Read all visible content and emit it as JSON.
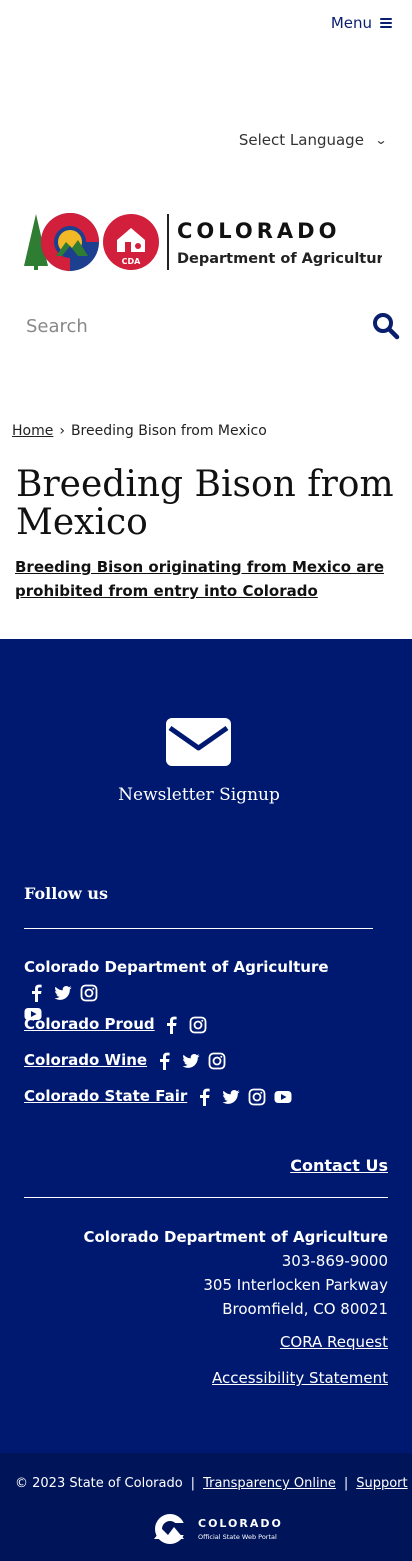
{
  "header": {
    "menu_label": "Menu",
    "language_label": "Select Language"
  },
  "logo": {
    "state_word": "COLORADO",
    "dept_name": "Department of Agriculture",
    "badge": "CDA"
  },
  "search": {
    "placeholder": "Search"
  },
  "breadcrumb": {
    "home": "Home",
    "separator": "›",
    "current": "Breeding Bison from Mexico"
  },
  "page": {
    "title": "Breeding Bison from Mexico",
    "link": "Breeding Bison originating from Mexico are prohibited from entry into Colorado"
  },
  "footer": {
    "newsletter_label": "Newsletter Signup",
    "follow_heading": "Follow us",
    "social": [
      {
        "name": "Colorado Department of Agriculture",
        "icons": [
          "facebook-icon",
          "twitter-icon",
          "instagram-icon",
          "youtube-icon"
        ]
      },
      {
        "name": "Colorado Proud",
        "icons": [
          "facebook-icon",
          "instagram-icon"
        ]
      },
      {
        "name": "Colorado Wine",
        "icons": [
          "facebook-icon",
          "twitter-icon",
          "instagram-icon"
        ]
      },
      {
        "name": "Colorado State Fair",
        "icons": [
          "facebook-icon",
          "twitter-icon",
          "instagram-icon",
          "youtube-icon"
        ]
      }
    ],
    "contact_label": "Contact Us",
    "org_name": "Colorado Department of Agriculture",
    "phone": "303-869-9000",
    "street": "305 Interlocken Parkway",
    "city": "Broomfield, CO 80021",
    "cora_label": "CORA Request",
    "accessibility_label": "Accessibility Statement"
  },
  "bottom": {
    "copyright": "© 2023 State of Colorado",
    "sep": "|",
    "transparency": "Transparency Online",
    "support": "Support",
    "portal_word": "COLORADO",
    "portal_sub": "Official State Web Portal"
  },
  "colors": {
    "navy": "#001970",
    "deep_navy": "#00145a",
    "colorado_red": "#d21f3c",
    "colorado_blue": "#1d3f8f",
    "gold": "#f2b825",
    "tree_green": "#2f7d32"
  }
}
